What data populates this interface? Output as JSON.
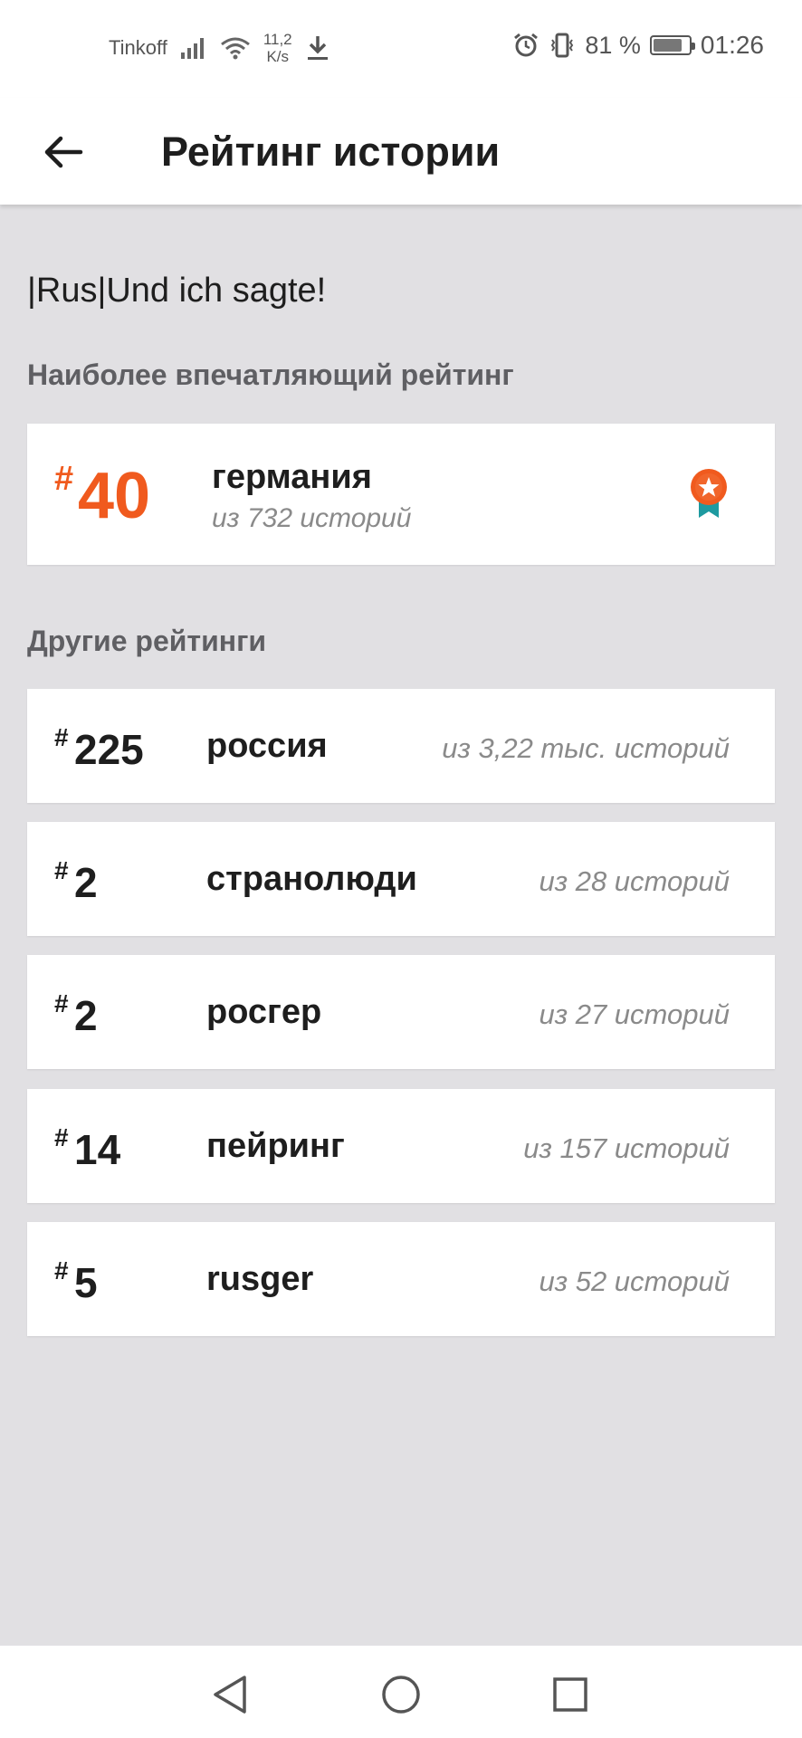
{
  "status_bar": {
    "carrier": "Tinkoff",
    "speed_value": "11,2",
    "speed_unit": "K/s",
    "battery_percent": "81 %",
    "time": "01:26"
  },
  "app_bar": {
    "title": "Рейтинг истории"
  },
  "story": {
    "title": "|Rus|Und ich sagte!"
  },
  "featured_section": {
    "label": "Наиболее впечатляющий рейтинг",
    "hash": "#",
    "rank": "40",
    "tag": "германия",
    "out_of": "из 732 историй",
    "accent_color": "#f05a1e"
  },
  "other_section": {
    "label": "Другие рейтинги",
    "items": [
      {
        "hash": "#",
        "rank": "225",
        "tag": "россия",
        "out_of": "из 3,22 тыс. историй"
      },
      {
        "hash": "#",
        "rank": "2",
        "tag": "странолюди",
        "out_of": "из 28 историй"
      },
      {
        "hash": "#",
        "rank": "2",
        "tag": "росгер",
        "out_of": "из 27 историй"
      },
      {
        "hash": "#",
        "rank": "14",
        "tag": "пейринг",
        "out_of": "из 157 историй"
      },
      {
        "hash": "#",
        "rank": "5",
        "tag": "rusger",
        "out_of": "из 52 историй"
      }
    ]
  },
  "icons": {
    "back": "arrow-left-icon",
    "award": "award-ribbon-icon",
    "nav_back": "triangle-back-icon",
    "nav_home": "circle-home-icon",
    "nav_recent": "square-recent-icon"
  }
}
